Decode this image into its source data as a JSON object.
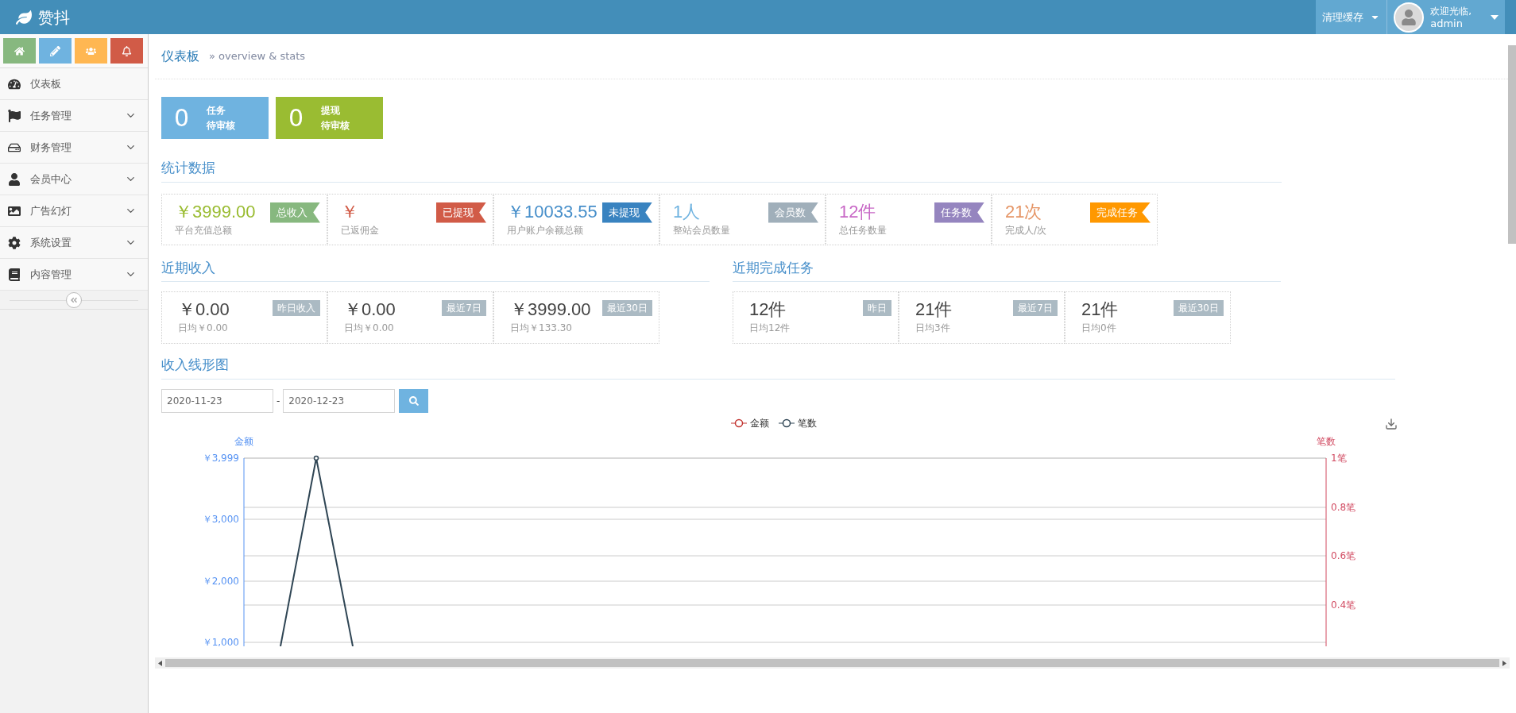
{
  "brand": "赞抖",
  "topbar": {
    "clear_cache": "清理缓存",
    "welcome": "欢迎光临,",
    "user": "admin"
  },
  "shortcuts": [
    {
      "kind": "home",
      "color": "#87b87f"
    },
    {
      "kind": "pencil",
      "color": "#6fb3e0"
    },
    {
      "kind": "users",
      "color": "#ffb752"
    },
    {
      "kind": "bell",
      "color": "#d15b47"
    }
  ],
  "sidebar": {
    "items": [
      {
        "kind": "dashboard",
        "label": "仪表板",
        "expandable": false
      },
      {
        "kind": "flag",
        "label": "任务管理",
        "expandable": true
      },
      {
        "kind": "drive",
        "label": "财务管理",
        "expandable": true
      },
      {
        "kind": "user",
        "label": "会员中心",
        "expandable": true
      },
      {
        "kind": "image",
        "label": "广告幻灯",
        "expandable": true
      },
      {
        "kind": "gear",
        "label": "系统设置",
        "expandable": true
      },
      {
        "kind": "book",
        "label": "内容管理",
        "expandable": true
      }
    ]
  },
  "breadcrumb": {
    "title": "仪表板",
    "subtitle": "» overview & stats"
  },
  "pending": [
    {
      "count": "0",
      "line1": "任务",
      "line2": "待审核",
      "color": "#6fb3e0"
    },
    {
      "count": "0",
      "line1": "提现",
      "line2": "待审核",
      "color": "#9abc32"
    }
  ],
  "stats": {
    "title": "统计数据",
    "cards": [
      {
        "value": "￥3999.00",
        "caption": "平台充值总额",
        "color": "#9abc32",
        "badge": {
          "label": "总收入",
          "color": "#87b87f"
        }
      },
      {
        "value": "￥",
        "caption": "已返佣金",
        "color": "#d15b47",
        "badge": {
          "label": "已提现",
          "color": "#d15b47"
        }
      },
      {
        "value": "￥10033.55",
        "caption": "用户账户余额总额",
        "color": "#478fca",
        "badge": {
          "label": "未提现",
          "color": "#3983c0"
        }
      },
      {
        "value": "1人",
        "caption": "整站会员数量",
        "color": "#6fb3e0",
        "badge": {
          "label": "会员数",
          "color": "#a0afba"
        }
      },
      {
        "value": "12件",
        "caption": "总任务数量",
        "color": "#c868c6",
        "badge": {
          "label": "任务数",
          "color": "#9585bf"
        }
      },
      {
        "value": "21次",
        "caption": "完成人/次",
        "color": "#e59566",
        "badge": {
          "label": "完成任务",
          "color": "#ff9800"
        }
      }
    ]
  },
  "recent_income": {
    "title": "近期收入",
    "cards": [
      {
        "value": "￥0.00",
        "badge": "昨日收入",
        "average": "日均￥0.00"
      },
      {
        "value": "￥0.00",
        "badge": "最近7日",
        "average": "日均￥0.00"
      },
      {
        "value": "￥3999.00",
        "badge": "最近30日",
        "average": "日均￥133.30"
      }
    ]
  },
  "recent_tasks": {
    "title": "近期完成任务",
    "cards": [
      {
        "value": "12件",
        "badge": "昨日",
        "average": "日均12件"
      },
      {
        "value": "21件",
        "badge": "最近7日",
        "average": "日均3件"
      },
      {
        "value": "21件",
        "badge": "最近30日",
        "average": "日均0件"
      }
    ]
  },
  "income_chart": {
    "title": "收入线形图",
    "date_from": "2020-11-23",
    "separator": "-",
    "date_to": "2020-12-23",
    "legend": [
      {
        "name": "金额",
        "color": "#c23531"
      },
      {
        "name": "笔数",
        "color": "#2f4554"
      }
    ],
    "left_axis": {
      "title": "金额",
      "ticks": [
        "￥3,999",
        "￥3,000",
        "￥2,000",
        "￥1,000"
      ]
    },
    "right_axis": {
      "title": "笔数",
      "ticks": [
        "1笔",
        "0.8笔",
        "0.6笔",
        "0.4笔"
      ]
    }
  }
}
